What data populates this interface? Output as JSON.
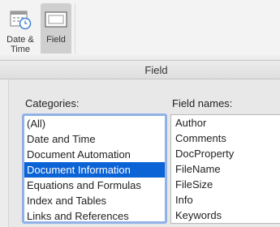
{
  "ribbon": {
    "buttons": [
      {
        "label_line1": "Date &",
        "label_line2": "Time",
        "icon": "calendar-clock-icon"
      },
      {
        "label_line1": "Field",
        "icon": "field-icon"
      }
    ]
  },
  "dialog": {
    "title": "Field",
    "categories_label": "Categories:",
    "field_names_label": "Field names:",
    "categories": [
      "(All)",
      "Date and Time",
      "Document Automation",
      "Document Information",
      "Equations and Formulas",
      "Index and Tables",
      "Links and References"
    ],
    "selected_category_index": 3,
    "field_names": [
      "Author",
      "Comments",
      "DocProperty",
      "FileName",
      "FileSize",
      "Info",
      "Keywords"
    ]
  },
  "colors": {
    "selection": "#0b63d6",
    "focus_ring": "#8fb2e8",
    "calendar_accent": "#3b7fd9"
  }
}
